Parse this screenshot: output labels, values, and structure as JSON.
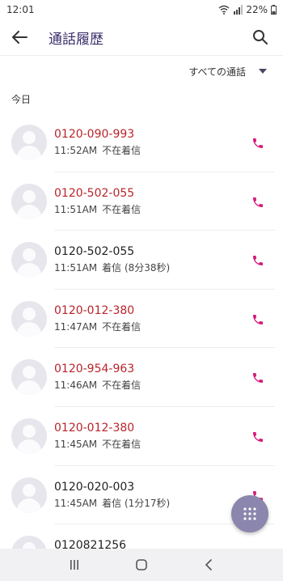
{
  "status_bar": {
    "time": "12:01",
    "battery": "22%"
  },
  "header": {
    "title": "通話履歴"
  },
  "filter": {
    "label": "すべての通話"
  },
  "section": {
    "label": "今日"
  },
  "calls": [
    {
      "number": "0120-090-993",
      "time": "11:52AM",
      "status": "不在着信",
      "missed": true
    },
    {
      "number": "0120-502-055",
      "time": "11:51AM",
      "status": "不在着信",
      "missed": true
    },
    {
      "number": "0120-502-055",
      "time": "11:51AM",
      "status": "着信 (8分38秒)",
      "missed": false
    },
    {
      "number": "0120-012-380",
      "time": "11:47AM",
      "status": "不在着信",
      "missed": true
    },
    {
      "number": "0120-954-963",
      "time": "11:46AM",
      "status": "不在着信",
      "missed": true
    },
    {
      "number": "0120-012-380",
      "time": "11:45AM",
      "status": "不在着信",
      "missed": true
    },
    {
      "number": "0120-020-003",
      "time": "11:45AM",
      "status": "着信 (1分17秒)",
      "missed": false
    },
    {
      "number": "0120821256",
      "time": "",
      "status": "",
      "missed": false
    }
  ],
  "colors": {
    "missed": "#b8242b",
    "call_icon": "#d6197a",
    "title": "#3a2d6b",
    "fab": "#8b86ad"
  },
  "icons": {
    "back": "arrow-left-icon",
    "search": "search-icon",
    "call": "phone-icon",
    "fab": "dialpad-icon",
    "nav_recent": "recent-apps-icon",
    "nav_home": "home-icon",
    "nav_back": "back-chevron-icon"
  }
}
